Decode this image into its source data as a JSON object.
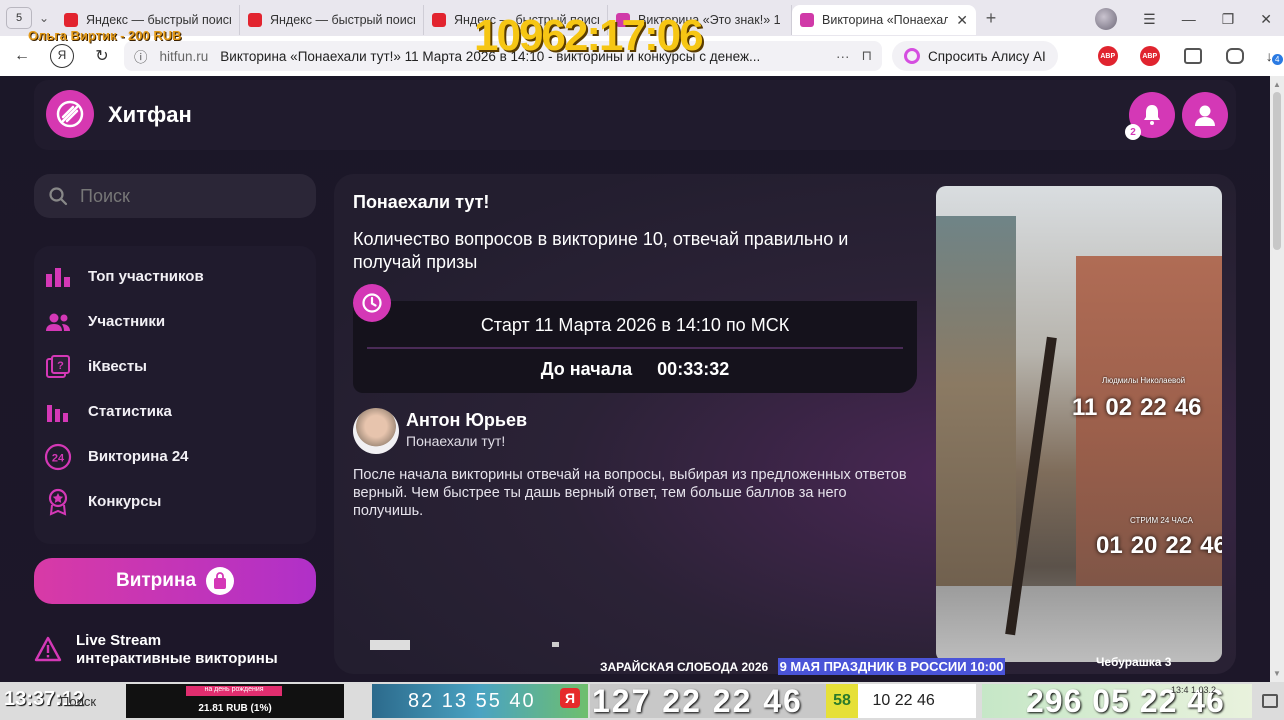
{
  "browser": {
    "tab_count": "5",
    "tabs": [
      {
        "title": "Яндекс — быстрый поиск",
        "color": "#e2242f",
        "active": false
      },
      {
        "title": "Яндекс — быстрый поиск",
        "color": "#e2242f",
        "active": false
      },
      {
        "title": "Яндекс — быстрый поиск",
        "color": "#e2242f",
        "active": false
      },
      {
        "title": "Викторина «Это знак!» 1",
        "color": "#d03aa8",
        "active": false
      },
      {
        "title": "Викторина «Понаехал",
        "color": "#d03aa8",
        "active": true
      }
    ],
    "url_host": "hitfun.ru",
    "page_title": "Викторина «Понаехали тут!» 11 Марта 2026 в 14:10 - викторины и конкурсы с денеж...",
    "alice_label": "Спросить Алису AI",
    "ext_labels": [
      "АВР",
      "АВР"
    ],
    "download_badge": "4"
  },
  "overlay": {
    "big_timer": "10962:17:06",
    "donor": "Ольга Виртик - 200 RUB"
  },
  "site": {
    "brand": "Хитфан",
    "notif_count": "2",
    "search_placeholder": "Поиск",
    "menu": [
      {
        "label": "Топ участников",
        "icon": "bar-chart-icon"
      },
      {
        "label": "Участники",
        "icon": "users-icon"
      },
      {
        "label": "iКвесты",
        "icon": "quest-icon"
      },
      {
        "label": "Статистика",
        "icon": "stats-icon"
      },
      {
        "label": "Викторина 24",
        "icon": "24-icon"
      },
      {
        "label": "Конкурсы",
        "icon": "medal-icon"
      }
    ],
    "vitrina_label": "Витрина",
    "live_title": "Live Stream",
    "live_sub": "интерактивные викторины",
    "accent": "#d438b6"
  },
  "quiz": {
    "title": "Понаехали тут!",
    "description": "Количество вопросов в викторине 10, отвечай правильно и получай призы",
    "start_text": "Старт 11 Марта 2026 в 14:10 по МСК",
    "countdown_label": "До начала",
    "countdown_value": "00:33:32",
    "author_name": "Антон Юрьев",
    "author_sub": "Понаехали тут!",
    "rules": "После начала викторины отвечай на вопросы, выбирая из предложенных ответов верный. Чем быстрее ты дашь верный ответ, тем больше баллов за него получишь."
  },
  "photo_overlay": {
    "label1": "Людмилы Николаевой",
    "nums1": [
      "11",
      "02",
      "22",
      "46"
    ],
    "label2": "СТРИМ 24 ЧАСА",
    "nums2": [
      "01",
      "20",
      "22",
      "46"
    ]
  },
  "ticker": {
    "left": "ЗАРАЙСКАЯ СЛОБОДА 2026",
    "highlight": "9 МАЯ ПРАЗДНИК В РОССИИ 10:00",
    "right": "Чебурашка 3"
  },
  "taskbar": {
    "time": "13:37:12",
    "search": "Поиск",
    "donate_banner": "на день рождения",
    "donate_amount": "21.81 RUB (1%)",
    "strip_nums": "82 13 55 40",
    "ya": "Я",
    "big_nums": "127 22 22 46",
    "yellow_num": "58",
    "yellow_rest": "10  22  46",
    "right_nums": "296 05 22 46",
    "right_small": "13:4\n1.03.2"
  }
}
